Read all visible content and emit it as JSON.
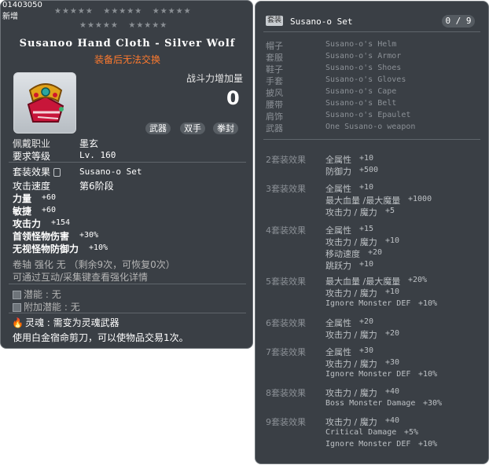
{
  "left": {
    "item_id": "01403050",
    "subtitle": "新增",
    "stars_row1": [
      "★★★★★",
      "★★★★★",
      "★★★★★"
    ],
    "stars_row2": [
      "★★★★★",
      "★★★★★"
    ],
    "title": "Susanoo Hand Cloth - Silver Wolf",
    "trade_note": "装备后无法交换",
    "combat_power_label": "战斗力增加量",
    "combat_power_value": "0",
    "tags": [
      "武器",
      "双手",
      "拳封"
    ],
    "job_label": "佩戴职业",
    "job_value": "墨玄",
    "level_label": "要求等级",
    "level_value": "Lv. 160",
    "set_label": "套装效果",
    "set_value": "Susano-o Set",
    "speed_label": "攻击速度",
    "speed_value": "第6阶段",
    "stats": [
      {
        "label": "力量",
        "value": "+60"
      },
      {
        "label": "敏捷",
        "value": "+60"
      },
      {
        "label": "攻击力",
        "value": "+154"
      },
      {
        "label": "首领怪物伤害",
        "value": "+30%"
      },
      {
        "label": "无视怪物防御力",
        "value": "+10%"
      }
    ],
    "scroll_line": "卷轴 强化 无 （剩余9次，可恢复0次）",
    "enhance_line": "可通过互动/采集键查看强化详情",
    "potential_label": "潜能",
    "potential_value": "无",
    "bonus_label": "附加潜能",
    "bonus_value": "无",
    "soul_label": "灵魂",
    "soul_value": "需变为灵魂武器",
    "footer": "使用白金宿命剪刀，可以使物品交易1次。"
  },
  "right": {
    "badge": "套装",
    "set_name": "Susano-o Set",
    "count": "0 / 9",
    "pieces": [
      {
        "slot": "帽子",
        "name": "Susano-o's Helm"
      },
      {
        "slot": "套服",
        "name": "Susano-o's Armor"
      },
      {
        "slot": "鞋子",
        "name": "Susano-o's Shoes"
      },
      {
        "slot": "手套",
        "name": "Susano-o's Gloves"
      },
      {
        "slot": "披风",
        "name": "Susano-o's Cape"
      },
      {
        "slot": "腰带",
        "name": "Susano-o's Belt"
      },
      {
        "slot": "肩饰",
        "name": "Susano-o's Epaulet"
      },
      {
        "slot": "武器",
        "name": "One Susano-o weapon"
      }
    ],
    "effects": [
      {
        "label": "2套装效果",
        "lines": [
          [
            "全属性",
            "+10"
          ],
          [
            "防御力",
            "+500"
          ]
        ]
      },
      {
        "label": "3套装效果",
        "lines": [
          [
            "全属性",
            "+10"
          ],
          [
            "最大血量 /最大魔量",
            "+1000"
          ],
          [
            "攻击力 / 魔力",
            "+5"
          ]
        ]
      },
      {
        "label": "4套装效果",
        "lines": [
          [
            "全属性",
            "+15"
          ],
          [
            "攻击力 / 魔力",
            "+10"
          ],
          [
            "移动速度",
            "+20"
          ],
          [
            "跳跃力",
            "+10"
          ]
        ]
      },
      {
        "label": "5套装效果",
        "lines": [
          [
            "最大血量 /最大魔量",
            "+20%"
          ],
          [
            "攻击力 / 魔力",
            "+10"
          ],
          [
            "Ignore Monster DEF",
            "+10%"
          ]
        ]
      },
      {
        "label": "6套装效果",
        "lines": [
          [
            "全属性",
            "+20"
          ],
          [
            "攻击力 / 魔力",
            "+20"
          ]
        ]
      },
      {
        "label": "7套装效果",
        "lines": [
          [
            "全属性",
            "+30"
          ],
          [
            "攻击力 / 魔力",
            "+30"
          ],
          [
            "Ignore Monster DEF",
            "+10%"
          ]
        ]
      },
      {
        "label": "8套装效果",
        "lines": [
          [
            "攻击力 / 魔力",
            "+40"
          ],
          [
            "Boss Monster Damage",
            "+30%"
          ]
        ]
      },
      {
        "label": "9套装效果",
        "lines": [
          [
            "攻击力 / 魔力",
            "+40"
          ],
          [
            "Critical Damage",
            "+5%"
          ],
          [
            "Ignore Monster DEF",
            "+10%"
          ]
        ]
      }
    ]
  }
}
